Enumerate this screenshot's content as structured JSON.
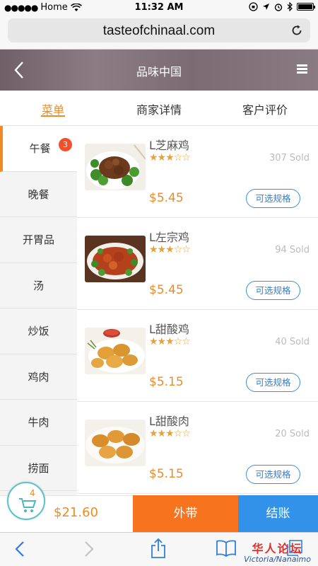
{
  "status_bar": {
    "carrier": "Home",
    "time": "11:32 AM"
  },
  "browser": {
    "url": "tasteofchinaal.com"
  },
  "header": {
    "title": "品味中国"
  },
  "tabs": [
    {
      "label": "菜单",
      "active": true
    },
    {
      "label": "商家详情",
      "active": false
    },
    {
      "label": "客户评价",
      "active": false
    }
  ],
  "sidebar": {
    "items": [
      {
        "label": "午餐",
        "active": true
      },
      {
        "label": "晚餐"
      },
      {
        "label": "开胃品"
      },
      {
        "label": "汤"
      },
      {
        "label": "炒饭"
      },
      {
        "label": "鸡肉"
      },
      {
        "label": "牛肉"
      },
      {
        "label": "捞面"
      }
    ],
    "badge": "3"
  },
  "dishes": [
    {
      "name": "L芝麻鸡",
      "rating": 3,
      "sold": "307 Sold",
      "price": "$5.45",
      "spec_label": "可选规格"
    },
    {
      "name": "L左宗鸡",
      "rating": 3,
      "sold": "94 Sold",
      "price": "$5.45",
      "spec_label": "可选规格"
    },
    {
      "name": "L甜酸鸡",
      "rating": 3,
      "sold": "40 Sold",
      "price": "$5.15",
      "spec_label": "可选规格"
    },
    {
      "name": "L甜酸肉",
      "rating": 3,
      "sold": "20 Sold",
      "price": "$5.15",
      "spec_label": "可选规格"
    }
  ],
  "cart": {
    "count": "4",
    "total": "$21.60",
    "takeout_label": "外带",
    "checkout_label": "结账"
  },
  "watermark": {
    "cn": "华人论坛",
    "en": "Victoria/Nanaimo"
  },
  "icons": {
    "back": "chevron-left-icon",
    "menu": "hamburger-icon",
    "reload": "reload-icon",
    "cart": "cart-icon",
    "share": "share-icon",
    "bookmarks": "book-icon",
    "tabs": "tabs-icon"
  },
  "colors": {
    "accent": "#f08a24",
    "takeout": "#f7731d",
    "checkout": "#3292ea",
    "badge": "#f2502b"
  }
}
